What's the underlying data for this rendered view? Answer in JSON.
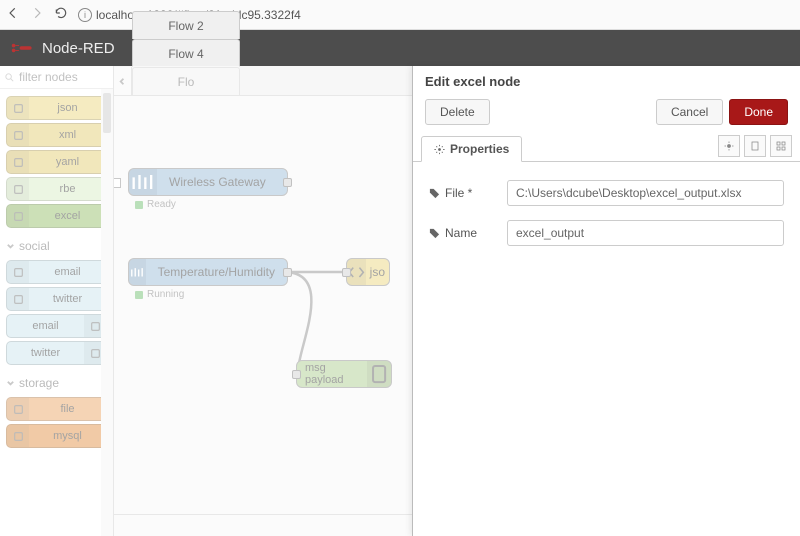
{
  "browser": {
    "url": "localhost:1880/#flow/21addc95.3322f4"
  },
  "header": {
    "title": "Node-RED"
  },
  "palette": {
    "search_placeholder": "filter nodes",
    "nodes_top": [
      {
        "name": "json",
        "cls": "c-yellow"
      },
      {
        "name": "xml",
        "cls": "c-yellow2"
      },
      {
        "name": "yaml",
        "cls": "c-yellow2"
      },
      {
        "name": "rbe",
        "cls": "c-greenL"
      },
      {
        "name": "excel",
        "cls": "c-greenD"
      }
    ],
    "cat1": "social",
    "social_nodes": [
      {
        "name": "email",
        "cls": "c-blueL",
        "icon_right": false
      },
      {
        "name": "twitter",
        "cls": "c-blueL",
        "icon_right": false
      },
      {
        "name": "email",
        "cls": "c-blueL",
        "icon_right": true
      },
      {
        "name": "twitter",
        "cls": "c-blueL",
        "icon_right": true
      }
    ],
    "cat2": "storage",
    "storage_nodes": [
      {
        "name": "file",
        "cls": "c-orange"
      },
      {
        "name": "mysql",
        "cls": "c-orangeD"
      }
    ]
  },
  "tabs": [
    "Flow 2",
    "Flow 4",
    "Flo"
  ],
  "canvas": {
    "n1": {
      "label": "Wireless Gateway",
      "status": "Ready"
    },
    "n2": {
      "label": "Temperature/Humidity",
      "status": "Running"
    },
    "n3": {
      "label": "jso"
    },
    "n4": {
      "label": "msg payload"
    }
  },
  "tray": {
    "title": "Edit excel node",
    "delete": "Delete",
    "cancel": "Cancel",
    "done": "Done",
    "tab": "Properties",
    "file_label": "File *",
    "file_value": "C:\\Users\\dcube\\Desktop\\excel_output.xlsx",
    "name_label": "Name",
    "name_value": "excel_output"
  }
}
